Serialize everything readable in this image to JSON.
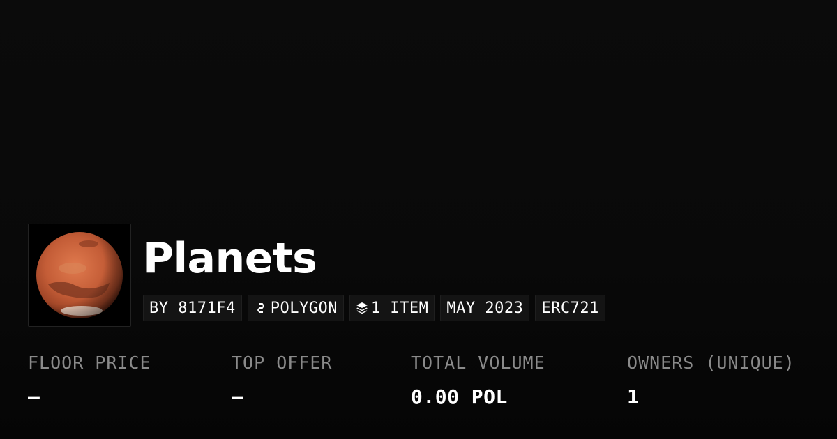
{
  "collection": {
    "name": "Planets",
    "image_icon": "planet-mars-image"
  },
  "chips": {
    "creator": "BY 8171F4",
    "chain": "POLYGON",
    "chain_icon": "polygon-icon",
    "items": "1 ITEM",
    "items_icon": "layers-icon",
    "date": "MAY 2023",
    "standard": "ERC721"
  },
  "stats": {
    "floor_price": {
      "label": "FLOOR PRICE",
      "value": "–"
    },
    "top_offer": {
      "label": "TOP OFFER",
      "value": "–"
    },
    "total_volume": {
      "label": "TOTAL VOLUME",
      "value": "0.00 POL"
    },
    "owners": {
      "label": "OWNERS (UNIQUE)",
      "value": "1"
    }
  },
  "colors": {
    "background": "#0a0a0a",
    "chip_background": "#141414",
    "label_gray": "#8a8a8a",
    "text": "#ffffff",
    "planet": "#c8623a"
  }
}
